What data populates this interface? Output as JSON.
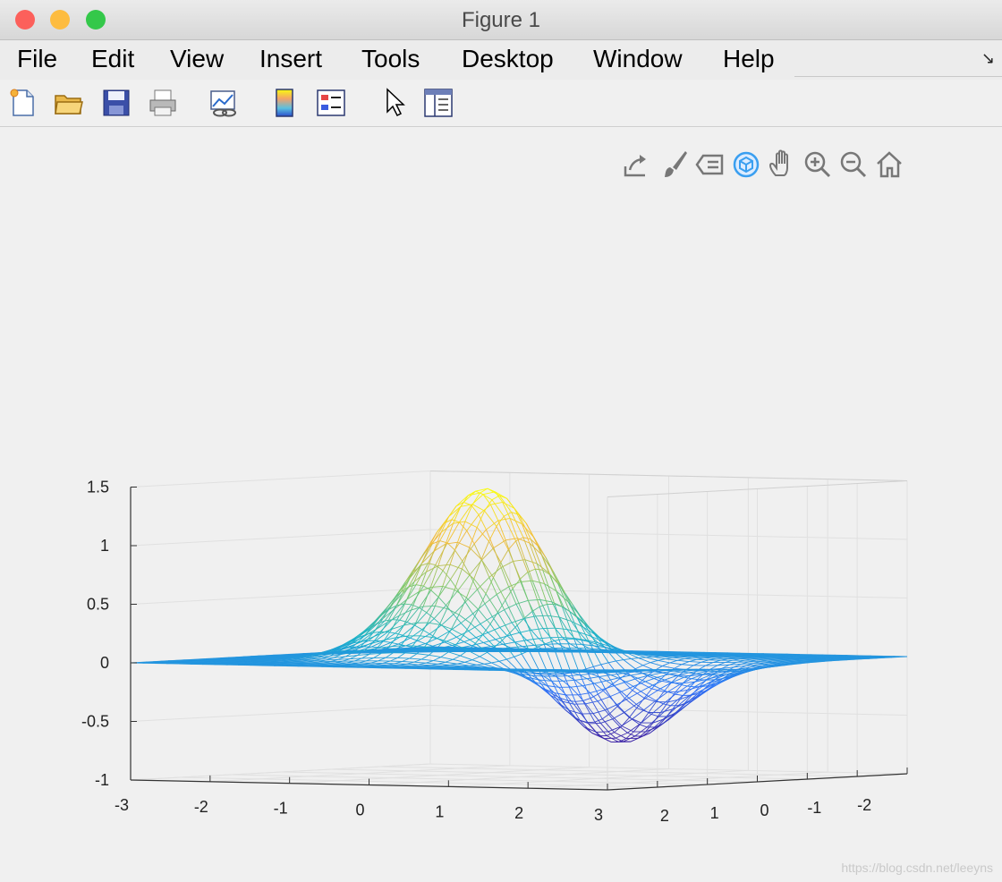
{
  "window": {
    "title": "Figure 1",
    "traffic_lights": [
      {
        "name": "close",
        "color": "#fc605b"
      },
      {
        "name": "minimize",
        "color": "#fdbc40"
      },
      {
        "name": "zoom",
        "color": "#34c84a"
      }
    ]
  },
  "menubar": {
    "items": [
      "File",
      "Edit",
      "View",
      "Insert",
      "Tools",
      "Desktop",
      "Window",
      "Help"
    ]
  },
  "toolbar": {
    "icons": [
      "new-figure-icon",
      "open-file-icon",
      "save-icon",
      "print-icon",
      "link-plot-icon",
      "colorbar-icon",
      "legend-icon",
      "edit-plot-icon",
      "property-inspector-icon"
    ]
  },
  "axes_toolbar": {
    "icons": [
      "export-icon",
      "brush-icon",
      "data-tips-icon",
      "rotate-3d-icon",
      "pan-icon",
      "zoom-in-icon",
      "zoom-out-icon",
      "home-icon"
    ]
  },
  "chart_data": {
    "type": "surface-mesh",
    "function": "z = 2*x*exp(-x^2-y^2) + exp(-x^2-y^2) style gaussian dipole",
    "zlim": [
      -1,
      1.5
    ],
    "ztick_labels": [
      "1.5",
      "1",
      "0.5",
      "0",
      "-0.5",
      "-1"
    ],
    "xtick_labels": [
      "-3",
      "-2",
      "-1",
      "0",
      "1",
      "2",
      "3"
    ],
    "ytick_labels": [
      "2",
      "1",
      "0",
      "-1",
      "-2"
    ],
    "peak": 1.43,
    "trough": -0.63,
    "colormap": [
      "#3e26a8",
      "#2e73f8",
      "#1ab3c8",
      "#7cc86c",
      "#f2b93b",
      "#f9fb0e"
    ],
    "grid": true
  },
  "watermark": "https://blog.csdn.net/leeyns"
}
